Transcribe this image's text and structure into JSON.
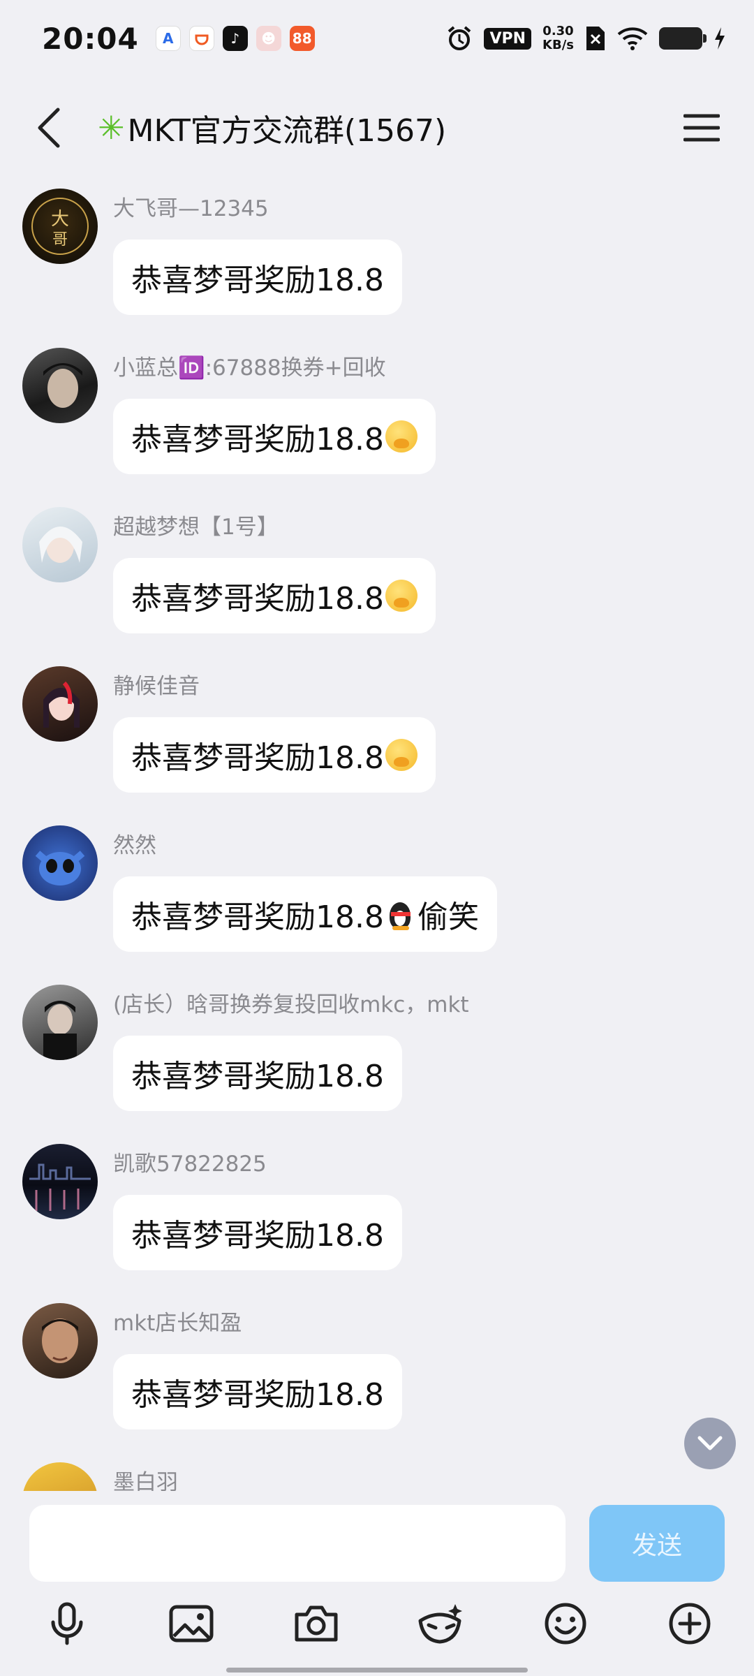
{
  "status_bar": {
    "time": "20:04",
    "vpn": "VPN",
    "speed_value": "0.30",
    "speed_unit": "KB/s"
  },
  "header": {
    "title": "MKT官方交流群(1567)",
    "title_prefix_icon": "green-asterisk-icon"
  },
  "messages": [
    {
      "sender": "大飞哥—12345",
      "text": "恭喜梦哥奖励18.8",
      "emoji": ""
    },
    {
      "sender": "小蓝总🆔:67888换券+回收",
      "text": "恭喜梦哥奖励18.8",
      "emoji": "face"
    },
    {
      "sender": "超越梦想【1号】",
      "text": "恭喜梦哥奖励18.8",
      "emoji": "face"
    },
    {
      "sender": "静候佳音",
      "text": "恭喜梦哥奖励18.8",
      "emoji": "face"
    },
    {
      "sender": "然然",
      "text": "恭喜梦哥奖励18.8",
      "emoji": "penguin",
      "suffix": "偷笑"
    },
    {
      "sender": "(店长）晗哥换券复投回收mkc，mkt",
      "text": "恭喜梦哥奖励18.8",
      "emoji": ""
    },
    {
      "sender": "凯歌57822825",
      "text": "恭喜梦哥奖励18.8",
      "emoji": ""
    },
    {
      "sender": "mkt店长知盈",
      "text": "恭喜梦哥奖励18.8",
      "emoji": ""
    },
    {
      "sender": "墨白羽",
      "text": "",
      "emoji": ""
    }
  ],
  "input": {
    "send_label": "发送"
  },
  "colors": {
    "background": "#f0f0f4",
    "bubble": "#ffffff",
    "send_button": "#7fc6f7",
    "accent_green": "#5bbf2a"
  }
}
